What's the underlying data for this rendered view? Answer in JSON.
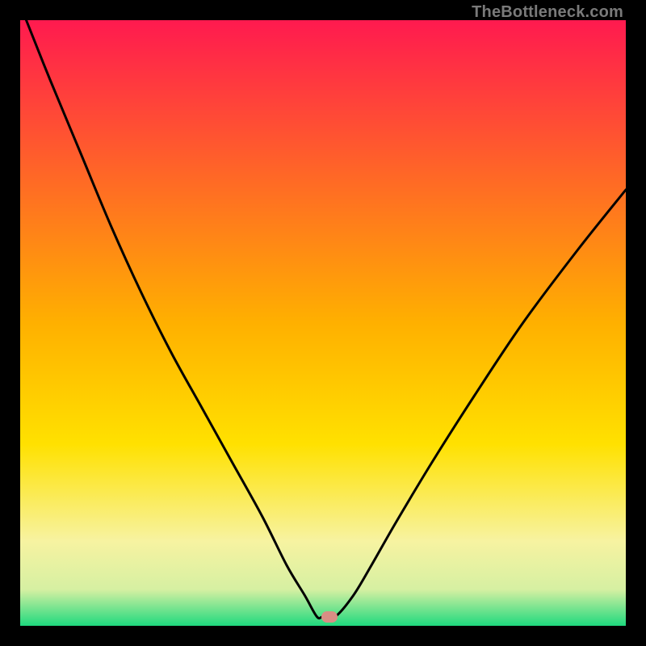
{
  "watermark": "TheBottleneck.com",
  "colors": {
    "frame": "#000000",
    "top": "#ff1a4f",
    "mid": "#ffd400",
    "lower": "#f7f3a1",
    "bottom": "#1fd97e",
    "curve": "#000000",
    "marker": "#d98d84"
  },
  "chart_data": {
    "type": "line",
    "title": "",
    "xlabel": "",
    "ylabel": "",
    "xlim": [
      0,
      100
    ],
    "ylim": [
      0,
      100
    ],
    "annotations": [
      {
        "type": "marker",
        "x": 51,
        "y": 1.5
      }
    ],
    "series": [
      {
        "name": "bottleneck-curve",
        "x": [
          1,
          5,
          10,
          15,
          20,
          25,
          30,
          35,
          40,
          44,
          47,
          49,
          50,
          52,
          55,
          58,
          62,
          68,
          75,
          83,
          92,
          100
        ],
        "y": [
          100,
          90,
          78,
          66,
          55,
          45,
          36,
          27,
          18,
          10,
          5,
          1.5,
          1.5,
          1.5,
          5,
          10,
          17,
          27,
          38,
          50,
          62,
          72
        ]
      }
    ],
    "gradient_stops": [
      {
        "offset": 0.0,
        "color": "#ff1a4f"
      },
      {
        "offset": 0.5,
        "color": "#ffb000"
      },
      {
        "offset": 0.7,
        "color": "#ffe100"
      },
      {
        "offset": 0.86,
        "color": "#f7f3a1"
      },
      {
        "offset": 0.94,
        "color": "#d6f0a2"
      },
      {
        "offset": 1.0,
        "color": "#1fd97e"
      }
    ]
  }
}
